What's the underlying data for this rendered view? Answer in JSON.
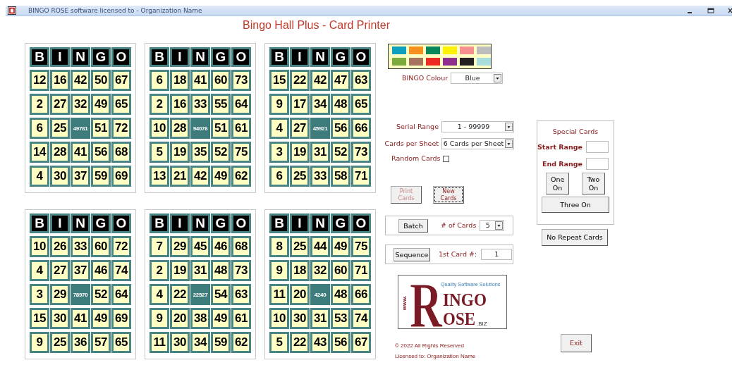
{
  "window": {
    "title": "BINGO ROSE software licensed to - Organization Name"
  },
  "heading": "Bingo Hall Plus - Card Printer",
  "cards": [
    {
      "header": [
        "B",
        "I",
        "N",
        "G",
        "O"
      ],
      "rows": [
        [
          "12",
          "16",
          "42",
          "50",
          "67"
        ],
        [
          "2",
          "27",
          "32",
          "49",
          "65"
        ],
        [
          "6",
          "25",
          "49781",
          "51",
          "72"
        ],
        [
          "14",
          "28",
          "41",
          "56",
          "68"
        ],
        [
          "4",
          "30",
          "37",
          "59",
          "69"
        ]
      ]
    },
    {
      "header": [
        "B",
        "I",
        "N",
        "G",
        "O"
      ],
      "rows": [
        [
          "6",
          "18",
          "41",
          "60",
          "73"
        ],
        [
          "2",
          "16",
          "33",
          "55",
          "64"
        ],
        [
          "10",
          "28",
          "94076",
          "51",
          "61"
        ],
        [
          "5",
          "19",
          "35",
          "52",
          "75"
        ],
        [
          "13",
          "21",
          "42",
          "49",
          "62"
        ]
      ]
    },
    {
      "header": [
        "B",
        "I",
        "N",
        "G",
        "O"
      ],
      "rows": [
        [
          "15",
          "22",
          "42",
          "47",
          "63"
        ],
        [
          "9",
          "17",
          "34",
          "48",
          "65"
        ],
        [
          "4",
          "27",
          "45921",
          "56",
          "66"
        ],
        [
          "3",
          "19",
          "31",
          "52",
          "73"
        ],
        [
          "6",
          "25",
          "33",
          "58",
          "71"
        ]
      ]
    },
    {
      "header": [
        "B",
        "I",
        "N",
        "G",
        "O"
      ],
      "rows": [
        [
          "10",
          "26",
          "33",
          "60",
          "72"
        ],
        [
          "4",
          "27",
          "37",
          "46",
          "74"
        ],
        [
          "3",
          "29",
          "78970",
          "52",
          "64"
        ],
        [
          "15",
          "30",
          "41",
          "49",
          "69"
        ],
        [
          "9",
          "25",
          "36",
          "57",
          "65"
        ]
      ]
    },
    {
      "header": [
        "B",
        "I",
        "N",
        "G",
        "O"
      ],
      "rows": [
        [
          "7",
          "29",
          "45",
          "46",
          "68"
        ],
        [
          "2",
          "19",
          "31",
          "48",
          "73"
        ],
        [
          "4",
          "22",
          "22527",
          "54",
          "63"
        ],
        [
          "9",
          "20",
          "38",
          "49",
          "61"
        ],
        [
          "11",
          "30",
          "34",
          "59",
          "62"
        ]
      ]
    },
    {
      "header": [
        "B",
        "I",
        "N",
        "G",
        "O"
      ],
      "rows": [
        [
          "8",
          "25",
          "44",
          "49",
          "75"
        ],
        [
          "9",
          "18",
          "32",
          "60",
          "71"
        ],
        [
          "11",
          "20",
          "4240",
          "48",
          "66"
        ],
        [
          "10",
          "30",
          "31",
          "53",
          "74"
        ],
        [
          "5",
          "22",
          "43",
          "56",
          "67"
        ]
      ]
    }
  ],
  "palette": [
    {
      "color": "#0f9fbf"
    },
    {
      "color": "#f7901e"
    },
    {
      "color": "#07875a"
    },
    {
      "color": "#fff200"
    },
    {
      "color": "#f78f8f"
    },
    {
      "color": "#bdbdbd"
    },
    {
      "color": "#7caa3c"
    },
    {
      "color": "#a6735e"
    },
    {
      "color": "#ee2a24"
    },
    {
      "color": "#8e2f8b"
    },
    {
      "color": "#231f20"
    },
    {
      "color": "#a9dcdc"
    }
  ],
  "bingo_colour": {
    "label": "BINGO Colour",
    "value": "Blue"
  },
  "serial_range": {
    "label": "Serial Range",
    "value": "1 - 99999"
  },
  "cards_per_sheet": {
    "label": "Cards per Sheet",
    "value": "6 Cards per Sheet"
  },
  "random_cards": {
    "label": "Random Cards",
    "checked": false
  },
  "print_cards": {
    "label": "Print Cards",
    "disabled": true,
    "focused": false
  },
  "new_cards": {
    "label": "New Cards",
    "disabled": false,
    "focused": true
  },
  "batch": {
    "button": "Batch",
    "label": "# of Cards",
    "value": "5"
  },
  "sequence": {
    "button": "Sequence",
    "label": "1st Card #:",
    "value": "1"
  },
  "logo": {
    "www": "www.",
    "big_letter": "R",
    "top": "INGO",
    "bottom": "OSE",
    "suffix": ".BIZ",
    "tagline": "Quality Software Solutions"
  },
  "special_cards": {
    "title": "Special Cards",
    "start_label": "Start Range",
    "end_label": "End Range",
    "buttons": [
      "One On",
      "Two On",
      "Three On"
    ]
  },
  "no_repeat": "No Repeat Cards",
  "exit": "Exit",
  "footer": [
    "© 2022 All Rights Reserved",
    "Licensed to: Organization Name"
  ]
}
